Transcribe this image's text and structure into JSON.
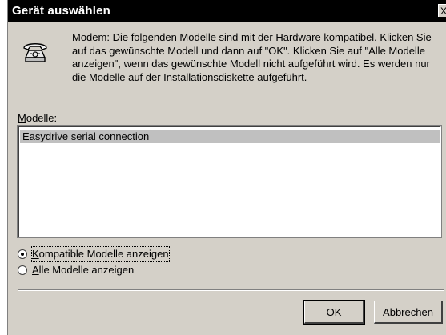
{
  "window": {
    "title": "Gerät auswählen",
    "close_glyph": "X"
  },
  "icon": "telephone-modem-icon",
  "description": "Modem: Die folgenden Modelle sind mit der Hardware kompatibel. Klicken Sie auf das gewünschte Modell und dann auf \"OK\". Klicken Sie auf \"Alle Modelle anzeigen\", wenn das gewünschte Modell nicht aufgeführt wird. Es werden nur die Modelle auf der Installationsdiskette aufgeführt.",
  "models": {
    "label_accel": "M",
    "label_rest": "odelle:",
    "items": [
      "Easydrive serial connection"
    ],
    "selected": "Easydrive serial connection"
  },
  "options": [
    {
      "accel": "K",
      "rest": "ompatible Modelle anzeigen",
      "checked": true
    },
    {
      "accel": "A",
      "rest": "lle Modelle anzeigen",
      "checked": false
    }
  ],
  "buttons": {
    "ok": "OK",
    "cancel": "Abbrechen"
  }
}
